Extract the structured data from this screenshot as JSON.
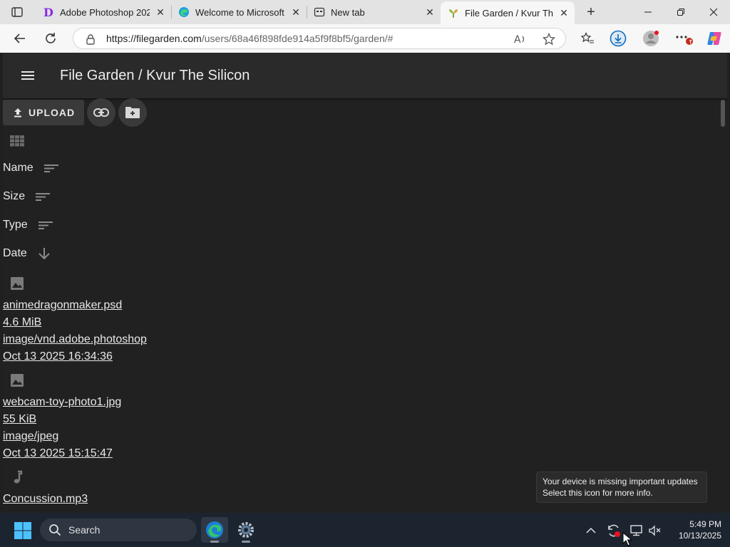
{
  "browser": {
    "tabs": [
      {
        "title": "Adobe Photoshop 2025",
        "favicon": "photoshop-d-icon"
      },
      {
        "title": "Welcome to Microsoft Edge",
        "favicon": "edge-icon"
      },
      {
        "title": "New tab",
        "favicon": "newtab-icon"
      },
      {
        "title": "File Garden / Kvur The Silicon",
        "favicon": "filegarden-icon",
        "active": true
      }
    ],
    "address": {
      "host": "https://filegarden.com",
      "path": "/users/68a46f898fde914a5f9f8bf5/garden/#"
    }
  },
  "app": {
    "title": "File Garden / Kvur The Silicon",
    "upload_label": "UPLOAD",
    "sort_fields": [
      "Name",
      "Size",
      "Type",
      "Date"
    ],
    "files": [
      {
        "icon": "image-icon",
        "name": "animedragonmaker.psd",
        "size": "4.6 MiB",
        "type": "image/vnd.adobe.photoshop",
        "date": "Oct 13 2025 16:34:36"
      },
      {
        "icon": "image-icon",
        "name": "webcam-toy-photo1.jpg",
        "size": "55 KiB",
        "type": "image/jpeg",
        "date": "Oct 13 2025 15:15:47"
      },
      {
        "icon": "music-note-icon",
        "name": "Concussion.mp3"
      }
    ]
  },
  "notification": {
    "line1": "Your device is missing important updates",
    "line2": "Select this icon for more info."
  },
  "taskbar": {
    "search_placeholder": "Search",
    "time": "5:49 PM",
    "date": "10/13/2025"
  },
  "colors": {
    "page_bg": "#212121",
    "appbar_bg": "#2a2a2a",
    "tabstrip_bg": "#e3e3e3",
    "taskbar_bg": "#1c2430"
  }
}
